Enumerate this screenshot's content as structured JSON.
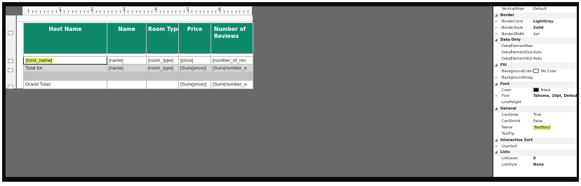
{
  "ruler": {
    "numbers": [
      "1",
      "2",
      "3",
      "4",
      "5",
      "6"
    ]
  },
  "table": {
    "headers": [
      "Host Name",
      "Name",
      "Room Type",
      "Price",
      "Number of Reviews"
    ],
    "detail": [
      "[host_name]",
      "[name]",
      "[room_type]",
      "[price]",
      "[number_of_rev"
    ],
    "total": [
      "Total for:",
      "[name]",
      "[room_type]",
      "[Sum(price)]",
      "[Sum(number_o"
    ],
    "grand": [
      "Grand Total:",
      "",
      "",
      "[Sum(price)]",
      "[Sum(number_o"
    ],
    "header_color": "#0e8a6b",
    "selection_color": "#d7f06a"
  },
  "properties": [
    {
      "type": "prop",
      "name": "VerticalAlign",
      "value": "Default"
    },
    {
      "type": "cat",
      "name": "Border"
    },
    {
      "type": "prop",
      "exp": ">",
      "name": "BorderColor",
      "value": "LightGrey",
      "bold": true
    },
    {
      "type": "prop",
      "exp": ">",
      "name": "BorderStyle",
      "value": "Solid",
      "bold": true
    },
    {
      "type": "prop",
      "exp": ">",
      "name": "BorderWidth",
      "value": "1pt"
    },
    {
      "type": "cat",
      "name": "Data Only"
    },
    {
      "type": "prop",
      "name": "DataElementNam",
      "value": ""
    },
    {
      "type": "prop",
      "name": "DataElementOutp",
      "value": "Auto"
    },
    {
      "type": "prop",
      "name": "DataElementStyle",
      "value": "Auto"
    },
    {
      "type": "cat",
      "name": "Fill"
    },
    {
      "type": "prop",
      "name": "BackgroundColor",
      "value": "No Color",
      "swatch": "#ffffff"
    },
    {
      "type": "prop",
      "exp": ">",
      "name": "BackgroundImag",
      "value": ""
    },
    {
      "type": "cat",
      "name": "Font"
    },
    {
      "type": "prop",
      "name": "Color",
      "value": "Black",
      "swatch": "#000000"
    },
    {
      "type": "prop",
      "exp": ">",
      "name": "Font",
      "value": "Tahoma, 10pt, Default",
      "bold": true
    },
    {
      "type": "prop",
      "name": "LineHeight",
      "value": ""
    },
    {
      "type": "cat",
      "name": "General"
    },
    {
      "type": "prop",
      "name": "CanGrow",
      "value": "True"
    },
    {
      "type": "prop",
      "name": "CanShrink",
      "value": "False"
    },
    {
      "type": "prop",
      "name": "Name",
      "value": "TextBox1",
      "highlight": true
    },
    {
      "type": "prop",
      "name": "ToolTip",
      "value": ""
    },
    {
      "type": "cat",
      "name": "Interactive Sort"
    },
    {
      "type": "prop",
      "exp": ">",
      "name": "UserSort",
      "value": ""
    },
    {
      "type": "cat",
      "name": "Lists"
    },
    {
      "type": "prop",
      "name": "ListLevel",
      "value": "0",
      "bold": true
    },
    {
      "type": "prop",
      "name": "ListStyle",
      "value": "None",
      "bold": true
    }
  ]
}
